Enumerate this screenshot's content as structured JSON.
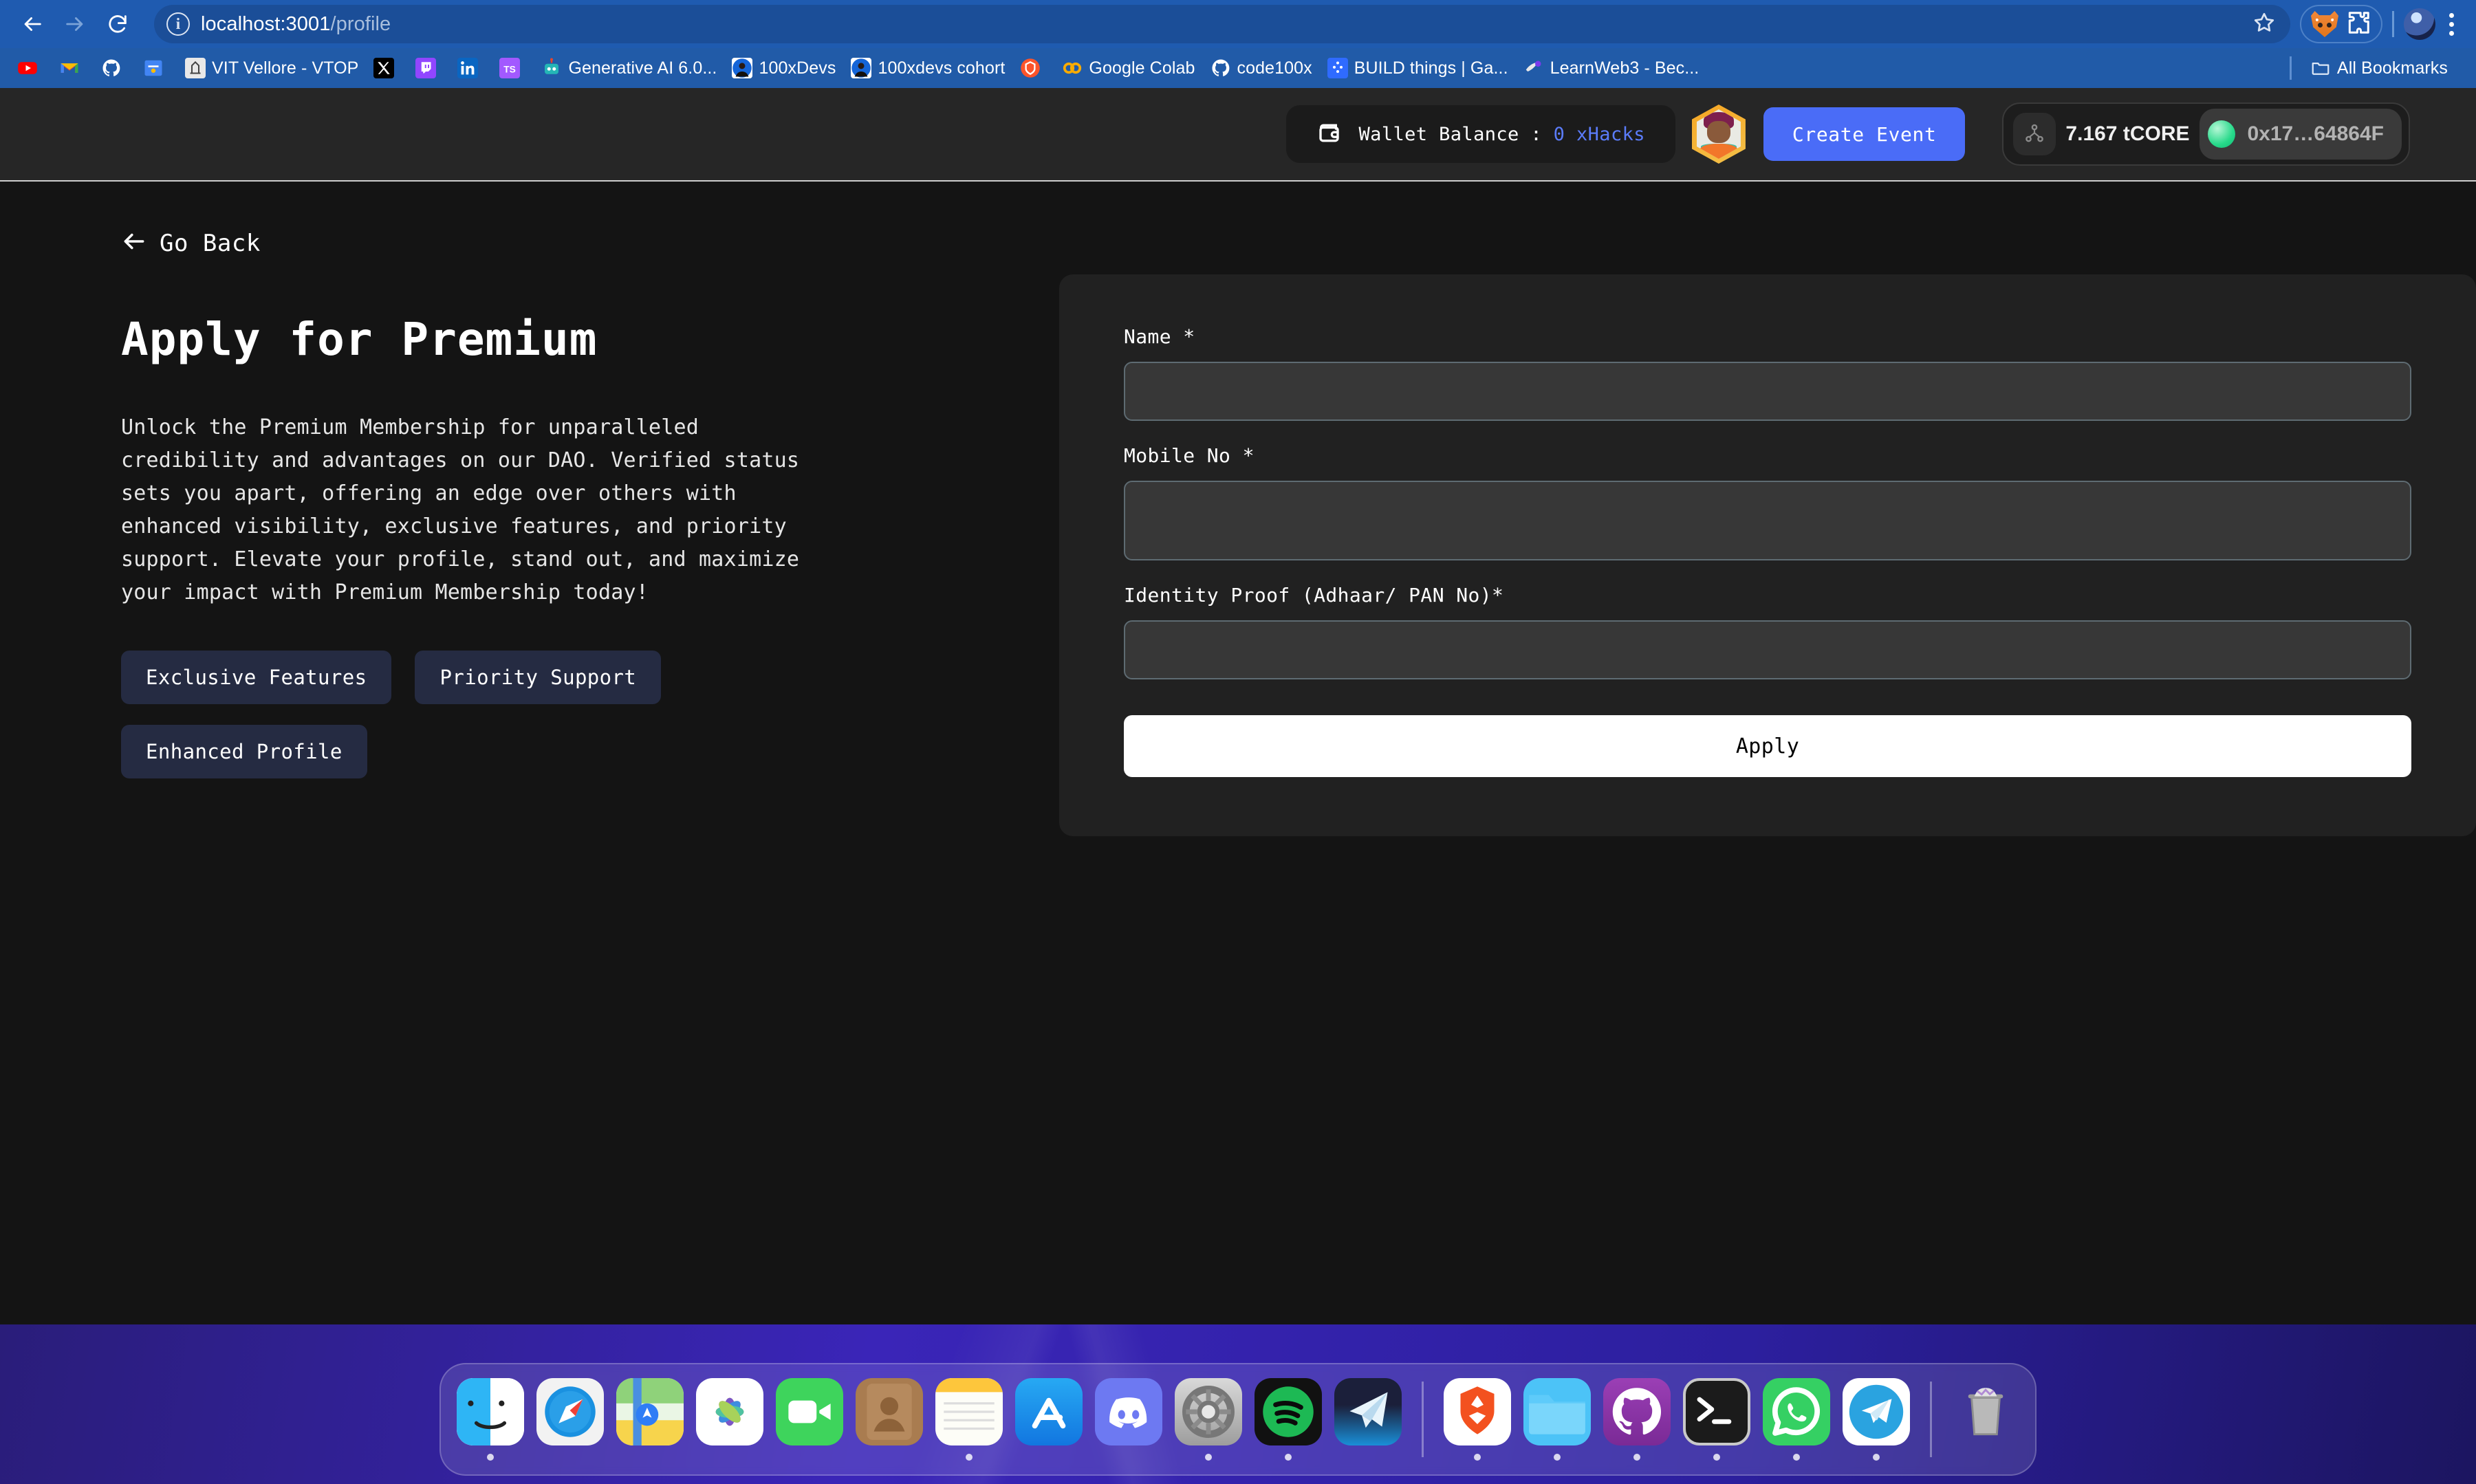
{
  "browser": {
    "url_host": "localhost:3001",
    "url_path": "/profile",
    "icons": {
      "back": "back-arrow-icon",
      "forward": "forward-arrow-icon",
      "reload": "reload-icon",
      "site_info": "site-info-icon",
      "bookmark_star": "bookmark-star-icon",
      "metamask": "metamask-fox-icon",
      "extensions": "extensions-puzzle-icon",
      "profile": "chrome-profile-avatar",
      "menu": "three-dot-menu-icon"
    },
    "bookmarks": [
      {
        "label": "",
        "icon": "youtube-icon"
      },
      {
        "label": "",
        "icon": "gmail-icon"
      },
      {
        "label": "",
        "icon": "github-icon"
      },
      {
        "label": "",
        "icon": "google-classroom-icon"
      },
      {
        "label": "VIT Vellore - VTOP",
        "icon": "vit-icon"
      },
      {
        "label": "",
        "icon": "x-twitter-icon"
      },
      {
        "label": "",
        "icon": "twitch-icon"
      },
      {
        "label": "",
        "icon": "linkedin-icon"
      },
      {
        "label": "",
        "icon": "typescript-icon"
      },
      {
        "label": "Generative AI 6.0...",
        "icon": "robot-icon"
      },
      {
        "label": "100xDevs",
        "icon": "person-photo-icon"
      },
      {
        "label": "100xdevs cohort",
        "icon": "person-photo-icon"
      },
      {
        "label": "",
        "icon": "brave-icon"
      },
      {
        "label": "Google Colab",
        "icon": "colab-icon"
      },
      {
        "label": "code100x",
        "icon": "github-icon"
      },
      {
        "label": "BUILD things | Ga...",
        "icon": "build-icon"
      },
      {
        "label": "LearnWeb3 - Bec...",
        "icon": "learnweb3-icon"
      }
    ],
    "all_bookmarks_label": "All Bookmarks",
    "all_bookmarks_icon": "folder-icon"
  },
  "app_header": {
    "wallet_icon": "wallet-icon",
    "wallet_label": "Wallet Balance :",
    "wallet_amount": "0 xHacks",
    "avatar_icon": "user-hex-avatar",
    "create_event_label": "Create Event",
    "network_icon": "network-nodes-icon",
    "balance": "7.167 tCORE",
    "status_dot": "connected-status-dot",
    "address": "0x17…64864F"
  },
  "page": {
    "go_back_label": "Go Back",
    "go_back_icon": "left-arrow-icon",
    "title": "Apply for Premium",
    "description": "Unlock the Premium Membership for unparalleled credibility and advantages on our DAO. Verified status sets you apart, offering an edge over others with enhanced visibility, exclusive features, and priority support. Elevate your profile, stand out, and maximize your impact with Premium Membership today!",
    "chips": [
      {
        "label": "Exclusive Features"
      },
      {
        "label": "Priority Support"
      },
      {
        "label": "Enhanced Profile"
      }
    ]
  },
  "form": {
    "fields": [
      {
        "label": "Name *",
        "value": "",
        "placeholder": ""
      },
      {
        "label": "Mobile No *",
        "value": "",
        "placeholder": ""
      },
      {
        "label": "Identity Proof (Adhaar/ PAN No)*",
        "value": "",
        "placeholder": ""
      }
    ],
    "submit_label": "Apply"
  },
  "dock": {
    "items": [
      {
        "name": "finder",
        "running": true
      },
      {
        "name": "safari",
        "running": false
      },
      {
        "name": "maps",
        "running": false
      },
      {
        "name": "photos",
        "running": false
      },
      {
        "name": "facetime",
        "running": false
      },
      {
        "name": "contacts",
        "running": false
      },
      {
        "name": "notes",
        "running": true
      },
      {
        "name": "app-store",
        "running": false
      },
      {
        "name": "discord",
        "running": false
      },
      {
        "name": "system-settings",
        "running": true
      },
      {
        "name": "spotify",
        "running": true
      },
      {
        "name": "telegram-desktop",
        "running": false
      },
      {
        "name": "brave",
        "running": true
      },
      {
        "name": "downloads-folder",
        "running": true
      },
      {
        "name": "github-desktop",
        "running": true
      },
      {
        "name": "terminal",
        "running": true
      },
      {
        "name": "whatsapp",
        "running": true
      },
      {
        "name": "telegram",
        "running": true
      },
      {
        "name": "trash",
        "running": false
      }
    ]
  },
  "colors": {
    "browser_blue": "#1f5bb0",
    "accent_blue": "#4a6cf7",
    "page_bg": "#141414",
    "card_bg": "#212121",
    "chip_bg": "#252b42",
    "status_green": "#27d98a"
  }
}
